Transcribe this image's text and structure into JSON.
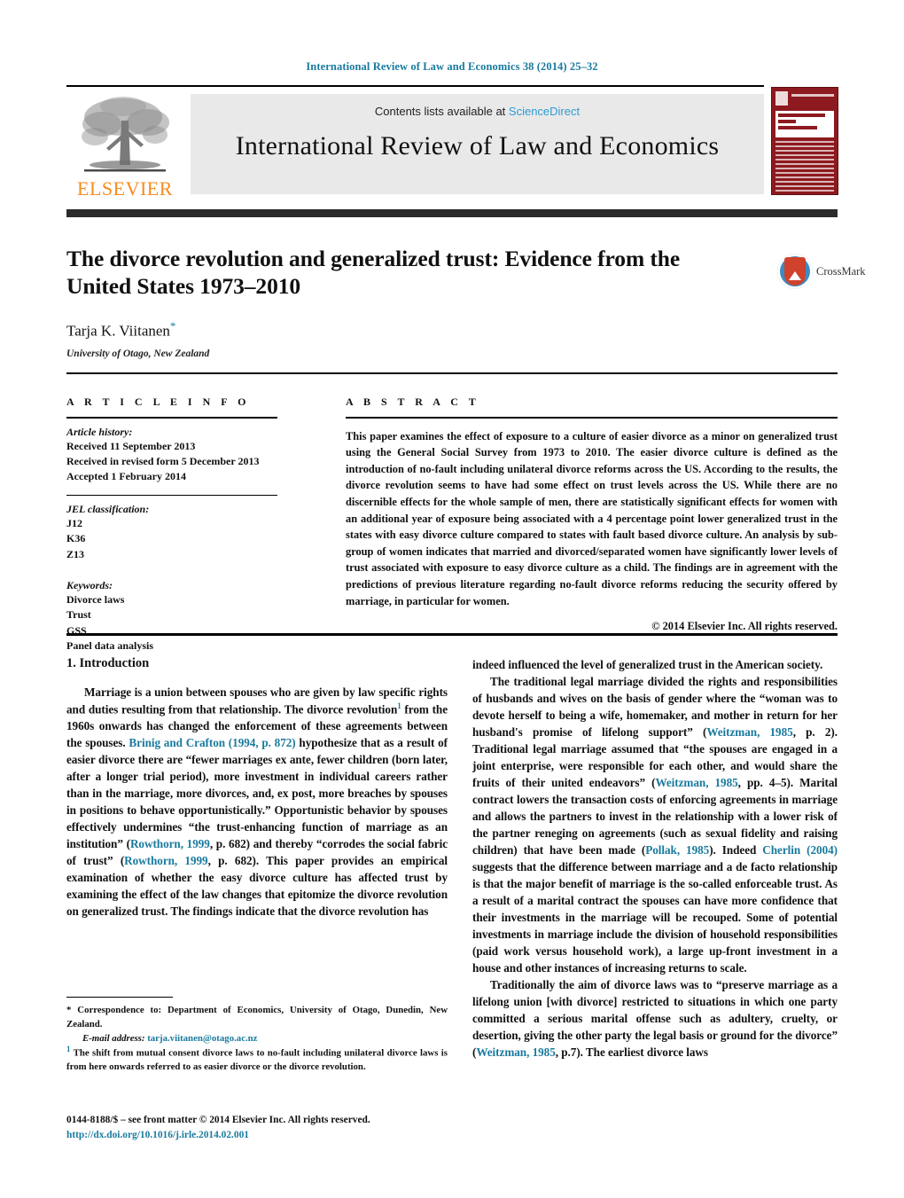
{
  "running_head": "International Review of Law and Economics 38 (2014) 25–32",
  "masthead": {
    "contents_prefix": "Contents lists available at ",
    "sciencedirect": "ScienceDirect",
    "journal_name": "International Review of Law and Economics",
    "publisher": "ELSEVIER",
    "publisher_logo": "elsevier-tree-logo",
    "cover_alt": "International Review of Law and Economics journal cover"
  },
  "article": {
    "title": "The divorce revolution and generalized trust: Evidence from the United States 1973–2010",
    "author": "Tarja K. Viitanen",
    "author_marker": "*",
    "affiliation": "University of Otago, New Zealand",
    "crossmark_label": "CrossMark"
  },
  "info": {
    "heading": "A R T I C L E  I N F O",
    "history_label": "Article history:",
    "history": [
      "Received 11 September 2013",
      "Received in revised form 5 December 2013",
      "Accepted 1 February 2014"
    ],
    "jel_label": "JEL classification:",
    "jel": [
      "J12",
      "K36",
      "Z13"
    ],
    "keywords_label": "Keywords:",
    "keywords": [
      "Divorce laws",
      "Trust",
      "GSS",
      "Panel data analysis"
    ]
  },
  "abstract": {
    "heading": "A B S T R A C T",
    "text": "This paper examines the effect of exposure to a culture of easier divorce as a minor on generalized trust using the General Social Survey from 1973 to 2010. The easier divorce culture is defined as the introduction of no-fault including unilateral divorce reforms across the US. According to the results, the divorce revolution seems to have had some effect on trust levels across the US. While there are no discernible effects for the whole sample of men, there are statistically significant effects for women with an additional year of exposure being associated with a 4 percentage point lower generalized trust in the states with easy divorce culture compared to states with fault based divorce culture. An analysis by sub-group of women indicates that married and divorced/separated women have significantly lower levels of trust associated with exposure to easy divorce culture as a child. The findings are in agreement with the predictions of previous literature regarding no-fault divorce reforms reducing the security offered by marriage, in particular for women.",
    "copyright": "© 2014 Elsevier Inc. All rights reserved."
  },
  "body": {
    "section_heading": "1.  Introduction",
    "left": {
      "p1_a": "Marriage is a union between spouses who are given by law specific rights and duties resulting from that relationship. The divorce revolution",
      "p1_fn": "1",
      "p1_b": " from the 1960s onwards has changed the enforcement of these agreements between the spouses. ",
      "p1_cite1": "Brinig and Crafton (1994, p. 872)",
      "p1_c": " hypothesize that as a result of easier divorce there are “fewer marriages ex ante, fewer children (born later, after a longer trial period), more investment in individual careers rather than in the marriage, more divorces, and, ex post, more breaches by spouses in positions to behave opportunistically.” Opportunistic behavior by spouses effectively undermines “the trust-enhancing function of marriage as an institution” (",
      "p1_cite2": "Rowthorn, 1999",
      "p1_d": ", p. 682) and thereby “corrodes the social fabric of trust” (",
      "p1_cite3": "Rowthorn, 1999",
      "p1_e": ", p. 682). This paper provides an empirical examination of whether the easy divorce culture has affected trust by examining the effect of the law changes that epitomize the divorce revolution on generalized trust. The findings indicate that the divorce revolution has"
    },
    "right": {
      "p1_cont": "indeed influenced the level of generalized trust in the American society.",
      "p2_a": "The traditional legal marriage divided the rights and responsibilities of husbands and wives on the basis of gender where the “woman was to devote herself to being a wife, homemaker, and mother in return for her husband's promise of lifelong support” (",
      "p2_cite1": "Weitzman, 1985",
      "p2_b": ", p. 2). Traditional legal marriage assumed that “the spouses are engaged in a joint enterprise, were responsible for each other, and would share the fruits of their united endeavors” (",
      "p2_cite2": "Weitzman, 1985",
      "p2_c": ", pp. 4–5). Marital contract lowers the transaction costs of enforcing agreements in marriage and allows the partners to invest in the relationship with a lower risk of the partner reneging on agreements (such as sexual fidelity and raising children) that have been made (",
      "p2_cite3": "Pollak, 1985",
      "p2_d": "). Indeed ",
      "p2_cite4": "Cherlin (2004)",
      "p2_e": " suggests that the difference between marriage and a de facto relationship is that the major benefit of marriage is the so-called enforceable trust. As a result of a marital contract the spouses can have more confidence that their investments in the marriage will be recouped. Some of potential investments in marriage include the division of household responsibilities (paid work versus household work), a large up-front investment in a house and other instances of increasing returns to scale.",
      "p3_a": "Traditionally the aim of divorce laws was to “preserve marriage as a lifelong union [with divorce] restricted to situations in which one party committed a serious marital offense such as adultery, cruelty, or desertion, giving the other party the legal basis or ground for the divorce” (",
      "p3_cite1": "Weitzman, 1985",
      "p3_b": ", p.7). The earliest divorce laws"
    }
  },
  "footnotes": {
    "correspondence": "* Correspondence to: Department of Economics, University of Otago, Dunedin, New Zealand.",
    "email_label": "E-mail address:",
    "email": "tarja.viitanen@otago.ac.nz",
    "note1_marker": "1",
    "note1": " The shift from mutual consent divorce laws to no-fault including unilateral divorce laws is from here onwards referred to as easier divorce or the divorce revolution."
  },
  "colophon": {
    "issn_line": "0144-8188/$ – see front matter © 2014 Elsevier Inc. All rights reserved.",
    "doi": "http://dx.doi.org/10.1016/j.irle.2014.02.001"
  },
  "colors": {
    "link": "#1a7a9e",
    "elsevier_orange": "#f68b1f",
    "cover_red": "#8d1a1f",
    "sciencedirect": "#2f9bd4"
  }
}
